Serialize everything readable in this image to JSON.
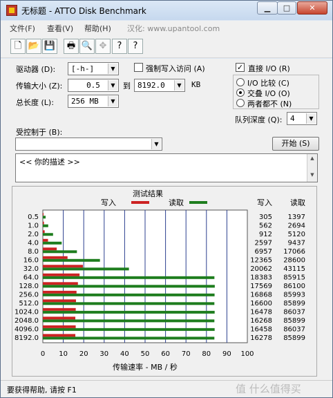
{
  "window": {
    "title": "无标题 - ATTO Disk Benchmark",
    "min": "▁",
    "max": "□",
    "close": "✕"
  },
  "menu": {
    "file": "文件(F)",
    "view": "查看(V)",
    "help": "帮助(H)",
    "localized": "汉化: www.upantool.com"
  },
  "toolbar": {
    "new": "🗋",
    "open": "📂",
    "save": "💾",
    "print": "🖶",
    "preview": "🔍",
    "move": "✥",
    "help": "?",
    "context_help": "?"
  },
  "drive": {
    "label": "驱动器 (D):",
    "value": "[-h-]"
  },
  "force_write": {
    "label": "强制写入访问 (A)",
    "checked": false
  },
  "transfer": {
    "label": "传输大小 (Z):",
    "from": "0.5",
    "to_label": "到",
    "to": "8192.0",
    "unit": "KB"
  },
  "length": {
    "label": "总长度 (L):",
    "value": "256 MB"
  },
  "direct_io": {
    "label": "直接 I/O (R)",
    "checked": true,
    "check_mark": "✓"
  },
  "io_mode": {
    "options": [
      {
        "label": "I/O 比较 (C)",
        "selected": false
      },
      {
        "label": "交叠 I/O (O)",
        "selected": true
      },
      {
        "label": "两者都不 (N)",
        "selected": false
      }
    ]
  },
  "queue": {
    "label": "队列深度 (Q):",
    "value": "4"
  },
  "controlled_by": {
    "label": "受控制于 (B):",
    "value": ""
  },
  "start_button": "开始 (S)",
  "description": "<<  你的描述  >>",
  "results": {
    "title": "测试结果",
    "legend_write": "写入",
    "legend_read": "读取",
    "col_write": "写入",
    "col_read": "读取",
    "xlabel": "传输速率 - MB / 秒",
    "write_color": "#cc2222",
    "read_color": "#1e7d1e"
  },
  "chart_data": {
    "type": "bar",
    "orientation": "horizontal",
    "categories": [
      "0.5",
      "1.0",
      "2.0",
      "4.0",
      "8.0",
      "16.0",
      "32.0",
      "64.0",
      "128.0",
      "256.0",
      "512.0",
      "1024.0",
      "2048.0",
      "4096.0",
      "8192.0"
    ],
    "series": [
      {
        "name": "写入",
        "values": [
          305,
          562,
          912,
          2597,
          6957,
          12365,
          20062,
          18383,
          17569,
          16868,
          16600,
          16478,
          16268,
          16458,
          16278
        ]
      },
      {
        "name": "读取",
        "values": [
          1397,
          2694,
          5120,
          9437,
          17066,
          28600,
          43115,
          85915,
          86100,
          85993,
          85899,
          86037,
          85899,
          86037,
          85899
        ]
      }
    ],
    "xticks": [
      "0",
      "10",
      "20",
      "30",
      "40",
      "50",
      "60",
      "70",
      "80",
      "90",
      "100"
    ],
    "xlim": [
      0,
      100
    ],
    "xlabel": "传输速率 - MB / 秒"
  },
  "status": "要获得帮助, 请按 F1",
  "watermark": "值 什么值得买"
}
